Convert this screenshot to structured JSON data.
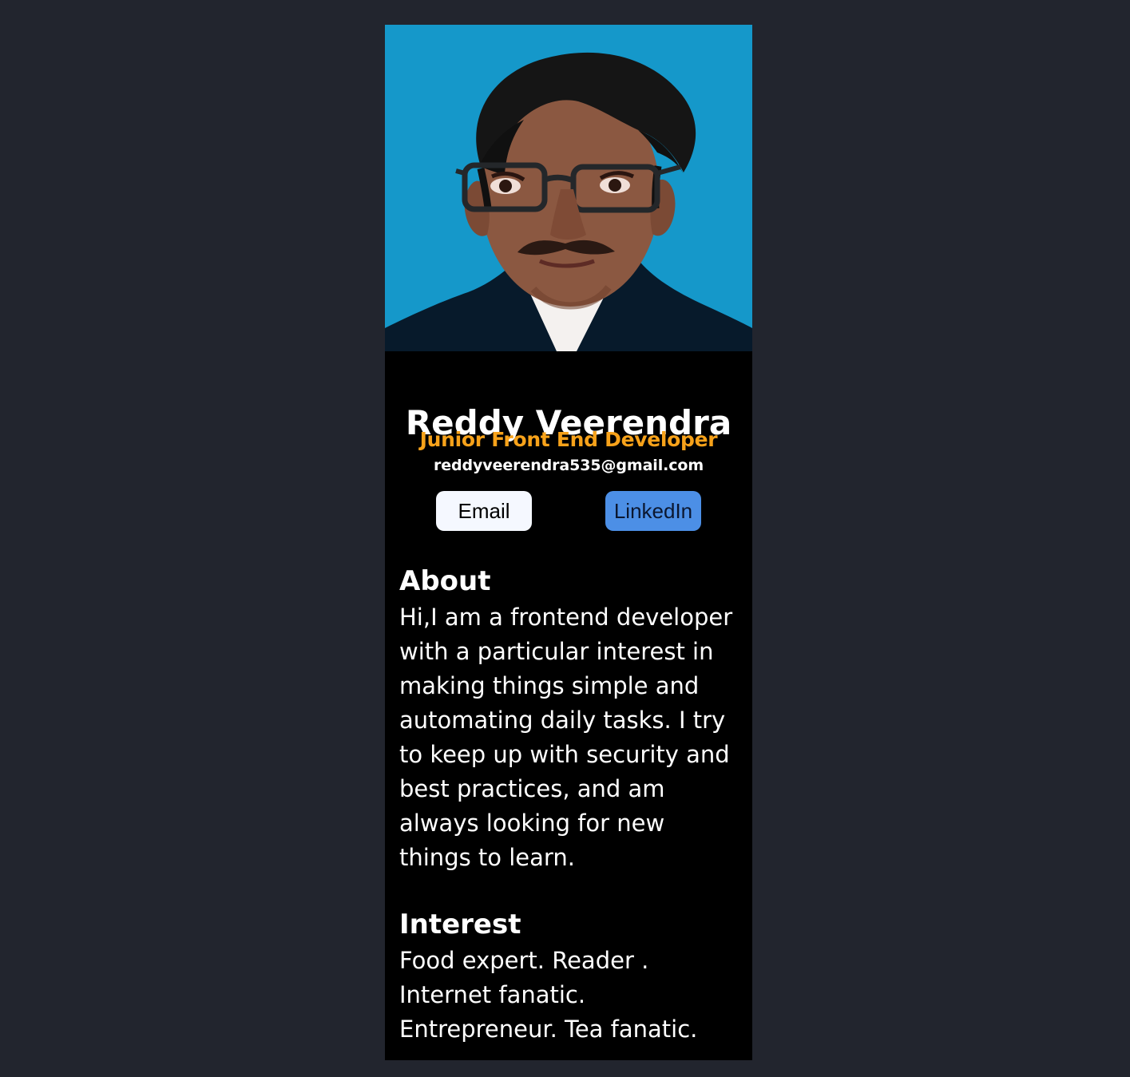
{
  "profile": {
    "photo_icon": "profile-photo",
    "name": "Reddy Veerendra",
    "role": "Junior Front End Developer",
    "email": "reddyveerendra535@gmail.com"
  },
  "buttons": {
    "email_label": "Email",
    "linkedin_label": "LinkedIn"
  },
  "sections": {
    "about": {
      "title": "About",
      "text": "Hi,I am a frontend developer with a particular interest in making things simple and automating daily tasks. I try to keep up with security and best practices, and am always looking for new things to learn."
    },
    "interest": {
      "title": "Interest",
      "text": "Food expert. Reader . Internet fanatic. Entrepreneur. Tea fanatic."
    }
  },
  "colors": {
    "background": "#22252e",
    "card": "#000000",
    "photo_background": "#1598ca",
    "role": "#f7a21a",
    "email_button": "#f5f8ff",
    "linkedin_button": "#4c8fe6"
  }
}
